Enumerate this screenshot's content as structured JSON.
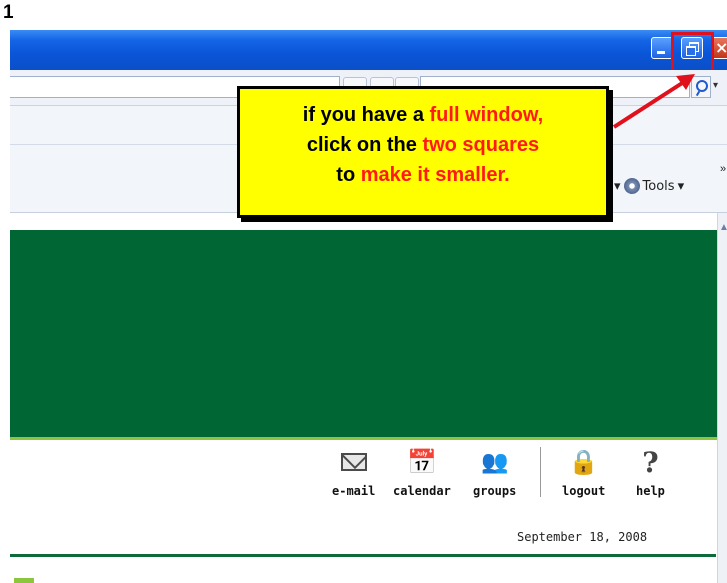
{
  "step_number": "1",
  "window_controls": {
    "minimize_icon": "minimize-icon",
    "restore_icon": "restore-icon",
    "close_icon": "close-icon",
    "close_glyph": "×"
  },
  "browser": {
    "search_dropdown_glyph": "▾",
    "tools_label": "Tools",
    "tools_chevron": "▾",
    "more_glyph": "»"
  },
  "callout": {
    "line1_prefix": "if you have a ",
    "line1_highlight": "full window,",
    "line2_prefix": "click on the ",
    "line2_highlight": "two squares",
    "line3_prefix": "to ",
    "line3_highlight": "make it smaller.",
    "highlight_color": "#ff1a1a",
    "background": "#ffff00"
  },
  "site_nav": {
    "items": [
      {
        "label": "e-mail",
        "icon": "envelope-icon"
      },
      {
        "label": "calendar",
        "icon": "calendar-icon"
      },
      {
        "label": "groups",
        "icon": "groups-icon"
      },
      {
        "label": "logout",
        "icon": "padlock-icon"
      },
      {
        "label": "help",
        "icon": "question-icon"
      }
    ]
  },
  "date": "September 18, 2008",
  "colors": {
    "banner_green": "#006633",
    "accent_lime": "#8cc63f",
    "annotation_red": "#e0101c"
  }
}
